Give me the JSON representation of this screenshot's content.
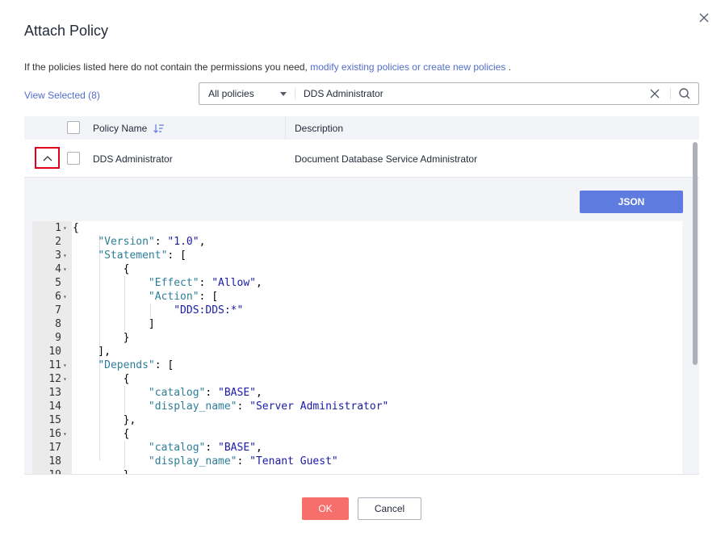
{
  "dialog": {
    "title": "Attach Policy",
    "hint_prefix": "If the policies listed here do not contain the permissions you need,",
    "hint_link": "modify existing policies or create new policies",
    "hint_suffix": " ."
  },
  "view_selected": "View Selected (8)",
  "search": {
    "scope": "All policies",
    "query": "DDS Administrator"
  },
  "table": {
    "headers": {
      "name": "Policy Name",
      "description": "Description"
    },
    "rows": [
      {
        "name": "DDS Administrator",
        "description": "Document Database Service Administrator"
      }
    ]
  },
  "panel": {
    "json_button": "JSON",
    "line_numbers": [
      "1",
      "2",
      "3",
      "4",
      "5",
      "6",
      "7",
      "8",
      "9",
      "10",
      "11",
      "12",
      "13",
      "14",
      "15",
      "16",
      "17",
      "18",
      "19"
    ]
  },
  "buttons": {
    "ok": "OK",
    "cancel": "Cancel"
  },
  "colors": {
    "accent": "#5e7ce0",
    "link": "#526ecc",
    "ok": "#f66f6a",
    "highlight": "#e0001b"
  },
  "icons": {
    "close": "close-icon",
    "sort": "sort-icon",
    "clear": "clear-icon",
    "search": "search-icon",
    "expand": "chevron-up-icon"
  }
}
